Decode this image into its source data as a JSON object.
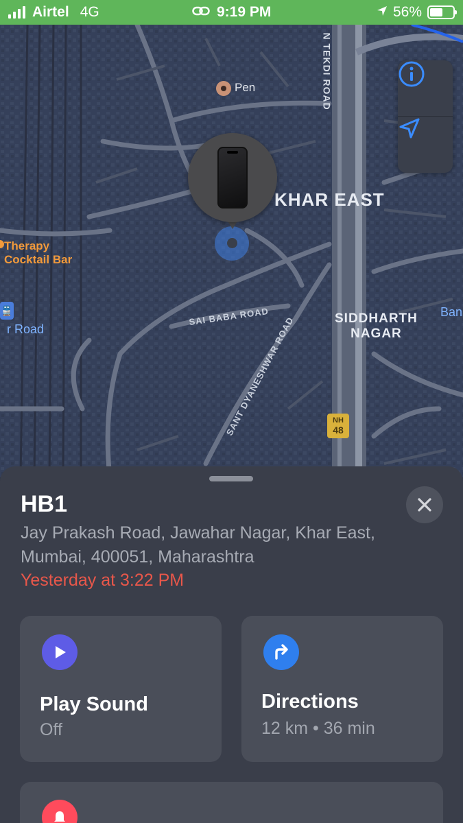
{
  "status_bar": {
    "carrier": "Airtel",
    "network": "4G",
    "time": "9:19 PM",
    "battery_percent": "56%",
    "battery_level": 0.56
  },
  "map": {
    "labels": {
      "khar_east": "KHAR EAST",
      "siddharth_line1": "SIDDHARTH",
      "siddharth_line2": "NAGAR",
      "sai_baba_road": "SAI BABA ROAD",
      "sant_road": "SANT DYANESHWAR ROAD",
      "tekdi_road": "N TEKDI ROAD",
      "therapy_line1": "Therapy",
      "therapy_line2": "Cocktail Bar",
      "road": "r Road",
      "ban": "Ban",
      "pen": "Pen",
      "nh_top": "NH",
      "nh_num": "48"
    }
  },
  "device": {
    "name": "HB1",
    "address": "Jay Prakash Road, Jawahar Nagar, Khar East, Mumbai, 400051, Maharashtra",
    "last_seen": "Yesterday at 3:22 PM"
  },
  "actions": {
    "play_sound": {
      "title": "Play Sound",
      "subtitle": "Off"
    },
    "directions": {
      "title": "Directions",
      "subtitle": "12 km • 36 min"
    }
  },
  "colors": {
    "status_bar": "#5fb65a",
    "sheet": "#3a3e4a",
    "card": "#4a4e59",
    "accent_red": "#e8574a",
    "play_icon": "#5e5ce6",
    "directions_icon": "#2f7fee",
    "lost_icon": "#ff4b5c",
    "map_blue": "#3a8cff"
  }
}
